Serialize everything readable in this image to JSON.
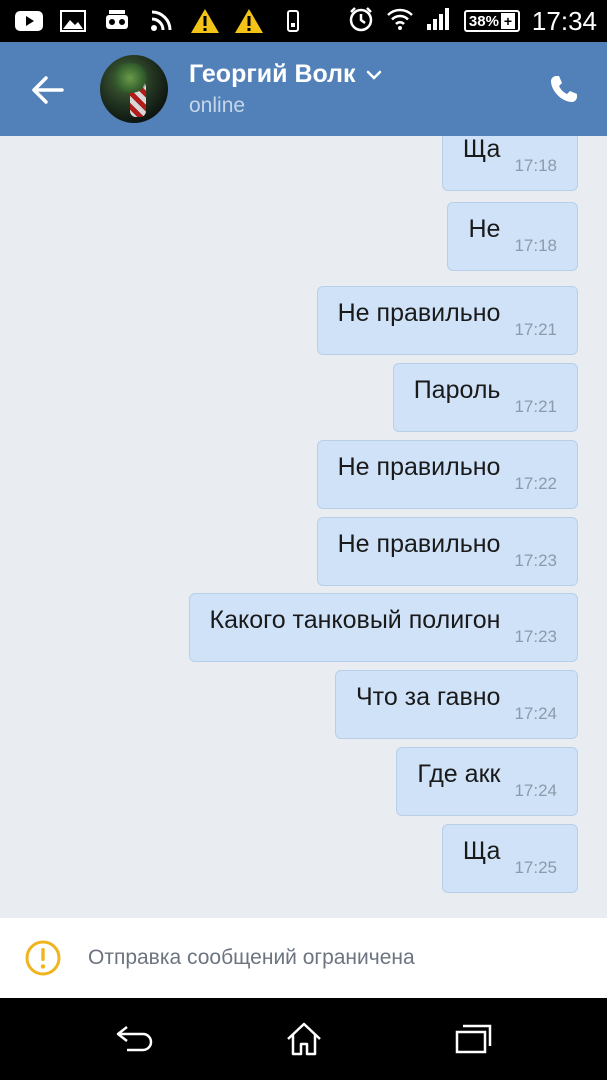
{
  "status_bar": {
    "battery_percent": "38%",
    "battery_plus": "+",
    "time": "17:34",
    "icons": [
      "youtube-icon",
      "gallery-icon",
      "game-icon",
      "rss-icon",
      "warning-icon",
      "warning-icon",
      "sim-icon",
      "alarm-icon",
      "wifi-icon",
      "signal-icon"
    ]
  },
  "header": {
    "contact_name": "Георгий Волк",
    "status": "online"
  },
  "messages": [
    {
      "text": "Ща",
      "time": "17:18"
    },
    {
      "text": "Не",
      "time": "17:18"
    },
    {
      "text": "Не правильно",
      "time": "17:21"
    },
    {
      "text": "Пароль",
      "time": "17:21"
    },
    {
      "text": "Не правильно",
      "time": "17:22"
    },
    {
      "text": "Не правильно",
      "time": "17:23"
    },
    {
      "text": "Какого танковый полигон",
      "time": "17:23"
    },
    {
      "text": "Что за гавно",
      "time": "17:24"
    },
    {
      "text": "Где акк",
      "time": "17:24"
    },
    {
      "text": "Ща",
      "time": "17:25"
    }
  ],
  "footer": {
    "restriction_text": "Отправка сообщений ограничена"
  },
  "colors": {
    "header_bg": "#5181b8",
    "bubble_bg": "#cfe2f7",
    "warning_accent": "#f0b41e"
  }
}
